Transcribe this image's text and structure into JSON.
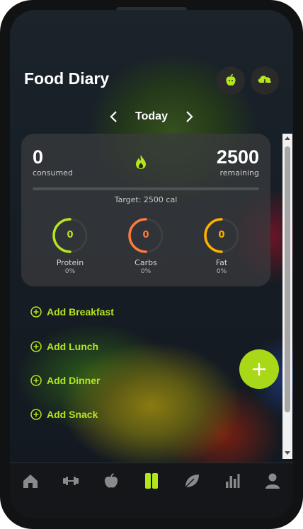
{
  "header": {
    "title": "Food Diary"
  },
  "date_nav": {
    "label": "Today"
  },
  "summary": {
    "consumed_value": "0",
    "consumed_label": "consumed",
    "remaining_value": "2500",
    "remaining_label": "remaining",
    "target_text": "Target: 2500 cal",
    "progress": 0
  },
  "macros": [
    {
      "name": "Protein",
      "value": "0",
      "percent": "0%",
      "color": "#b5e61d"
    },
    {
      "name": "Carbs",
      "value": "0",
      "percent": "0%",
      "color": "#ff7a3d"
    },
    {
      "name": "Fat",
      "value": "0",
      "percent": "0%",
      "color": "#ffb000"
    }
  ],
  "meals": [
    {
      "label": "Add Breakfast"
    },
    {
      "label": "Add Lunch"
    },
    {
      "label": "Add Dinner"
    },
    {
      "label": "Add Snack"
    }
  ],
  "tabs": [
    {
      "icon": "home-icon"
    },
    {
      "icon": "dumbbell-icon"
    },
    {
      "icon": "apple-icon"
    },
    {
      "icon": "diary-icon",
      "active": true
    },
    {
      "icon": "leaf-icon"
    },
    {
      "icon": "stats-icon"
    },
    {
      "icon": "profile-icon"
    }
  ],
  "colors": {
    "accent": "#b5e61d"
  }
}
